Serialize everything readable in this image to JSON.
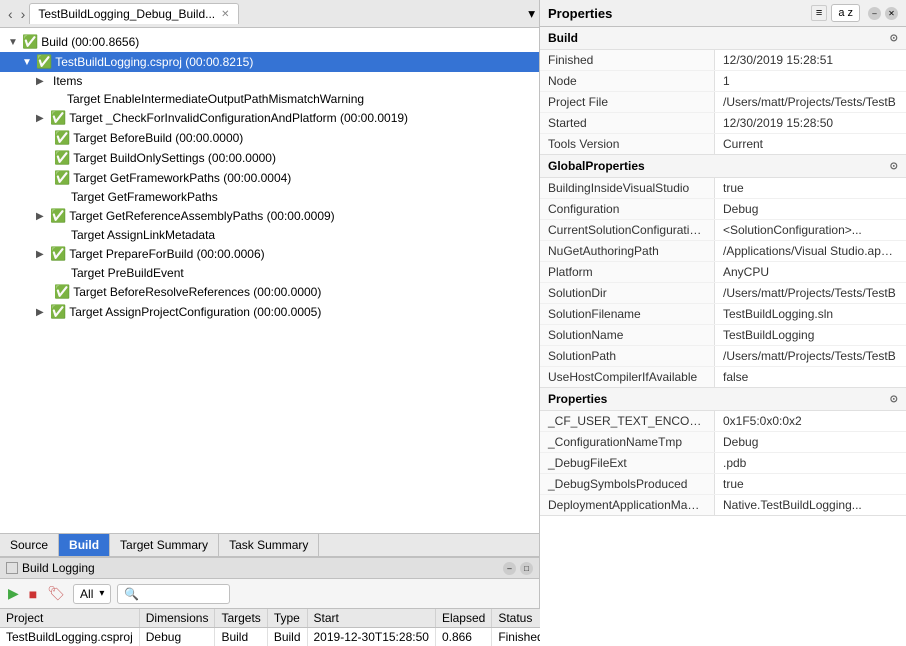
{
  "tabs": [
    {
      "label": "TestBuildLogging_Debug_Build...",
      "active": true
    }
  ],
  "build_tree": {
    "items": [
      {
        "indent": 0,
        "arrow": "▼",
        "icon": "✅",
        "label": "Build (00:00.8656)",
        "selected": false
      },
      {
        "indent": 1,
        "arrow": "▼",
        "icon": "✅",
        "label": "TestBuildLogging.csproj (00:00.8215)",
        "selected": true
      },
      {
        "indent": 2,
        "arrow": "▶",
        "icon": "",
        "label": "Items",
        "selected": false
      },
      {
        "indent": 2,
        "arrow": "",
        "icon": "",
        "label": "Target EnableIntermediateOutputPathMismatchWarning",
        "selected": false
      },
      {
        "indent": 2,
        "arrow": "▶",
        "icon": "✅",
        "label": "Target _CheckForInvalidConfigurationAndPlatform (00:00.0019)",
        "selected": false
      },
      {
        "indent": 2,
        "arrow": "",
        "icon": "✅",
        "label": "Target BeforeBuild (00:00.0000)",
        "selected": false
      },
      {
        "indent": 2,
        "arrow": "",
        "icon": "✅",
        "label": "Target BuildOnlySettings (00:00.0000)",
        "selected": false
      },
      {
        "indent": 2,
        "arrow": "",
        "icon": "✅",
        "label": "Target GetFrameworkPaths (00:00.0004)",
        "selected": false
      },
      {
        "indent": 2,
        "arrow": "",
        "icon": "",
        "label": "Target GetFrameworkPaths",
        "selected": false
      },
      {
        "indent": 2,
        "arrow": "▶",
        "icon": "✅",
        "label": "Target GetReferenceAssemblyPaths (00:00.0009)",
        "selected": false
      },
      {
        "indent": 2,
        "arrow": "",
        "icon": "",
        "label": "Target AssignLinkMetadata",
        "selected": false
      },
      {
        "indent": 2,
        "arrow": "▶",
        "icon": "✅",
        "label": "Target PrepareForBuild (00:00.0006)",
        "selected": false
      },
      {
        "indent": 2,
        "arrow": "",
        "icon": "",
        "label": "Target PreBuildEvent",
        "selected": false
      },
      {
        "indent": 2,
        "arrow": "",
        "icon": "✅",
        "label": "Target BeforeResolveReferences (00:00.0000)",
        "selected": false
      },
      {
        "indent": 2,
        "arrow": "▶",
        "icon": "✅",
        "label": "Target AssignProjectConfiguration (00:00.0005)",
        "selected": false
      }
    ]
  },
  "bottom_tabs": [
    {
      "label": "Source",
      "active": false
    },
    {
      "label": "Build",
      "active": true
    },
    {
      "label": "Target Summary",
      "active": false
    },
    {
      "label": "Task Summary",
      "active": false
    }
  ],
  "build_logging": {
    "title": "Build Logging",
    "toolbar": {
      "play_label": "▶",
      "stop_label": "■",
      "clear_label": "🏷",
      "filter_label": "All",
      "search_placeholder": ""
    },
    "table": {
      "columns": [
        "Project",
        "Dimensions",
        "Targets",
        "Type",
        "Start",
        "Elapsed",
        "Status"
      ],
      "rows": [
        {
          "project": "TestBuildLogging.csproj",
          "dimensions": "Debug",
          "targets": "Build",
          "type": "Build",
          "start": "2019-12-30T15:28:50",
          "elapsed": "0.866",
          "status": "Finished"
        }
      ]
    }
  },
  "properties": {
    "title": "Properties",
    "toolbar": {
      "sort_label": "a z"
    },
    "sections": [
      {
        "name": "Build",
        "rows": [
          {
            "key": "Finished",
            "value": "12/30/2019 15:28:51"
          },
          {
            "key": "Node",
            "value": "1"
          },
          {
            "key": "Project File",
            "value": "/Users/matt/Projects/Tests/TestB"
          },
          {
            "key": "Started",
            "value": "12/30/2019 15:28:50"
          },
          {
            "key": "Tools Version",
            "value": "Current"
          }
        ]
      },
      {
        "name": "GlobalProperties",
        "rows": [
          {
            "key": "BuildingInsideVisualStudio",
            "value": "true"
          },
          {
            "key": "Configuration",
            "value": "Debug"
          },
          {
            "key": "CurrentSolutionConfigurationC",
            "value": "<SolutionConfiguration>..."
          },
          {
            "key": "NuGetAuthoringPath",
            "value": "/Applications/Visual Studio.app/C"
          },
          {
            "key": "Platform",
            "value": "AnyCPU"
          },
          {
            "key": "SolutionDir",
            "value": "/Users/matt/Projects/Tests/TestB"
          },
          {
            "key": "SolutionFilename",
            "value": "TestBuildLogging.sln"
          },
          {
            "key": "SolutionName",
            "value": "TestBuildLogging"
          },
          {
            "key": "SolutionPath",
            "value": "/Users/matt/Projects/Tests/TestB"
          },
          {
            "key": "UseHostCompilerIfAvailable",
            "value": "false"
          }
        ]
      },
      {
        "name": "Properties",
        "rows": [
          {
            "key": "_CF_USER_TEXT_ENCODING",
            "value": "0x1F5:0x0:0x2"
          },
          {
            "key": "_ConfigurationNameTmp",
            "value": "Debug"
          },
          {
            "key": "_DebugFileExt",
            "value": ".pdb"
          },
          {
            "key": "_DebugSymbolsProduced",
            "value": "true"
          },
          {
            "key": "DeploymentApplicationManife",
            "value": "Native.TestBuildLogging..."
          }
        ]
      }
    ]
  }
}
